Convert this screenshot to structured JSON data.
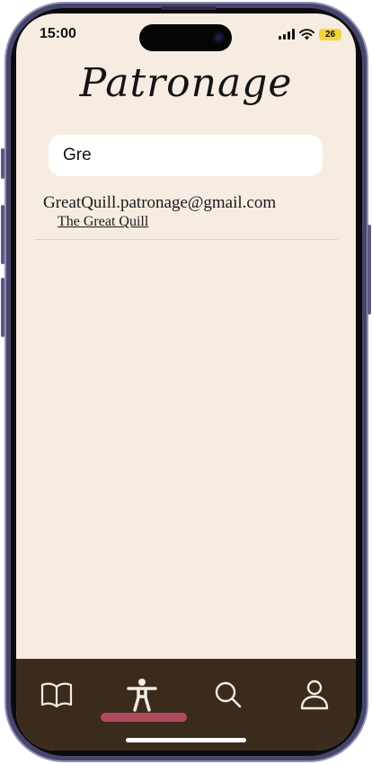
{
  "status_bar": {
    "time": "15:00",
    "battery_level": "26",
    "icons": [
      "signal-icon",
      "wifi-icon",
      "battery-icon"
    ]
  },
  "app": {
    "title": "Patronage"
  },
  "search": {
    "value": "Gre",
    "placeholder": ""
  },
  "results": [
    {
      "email": "GreatQuill.patronage@gmail.com",
      "name": "The Great Quill"
    }
  ],
  "tab_bar": {
    "tabs": [
      {
        "icon": "book-icon",
        "active": false
      },
      {
        "icon": "accessibility-person-icon",
        "active": true
      },
      {
        "icon": "search-icon",
        "active": false
      },
      {
        "icon": "profile-icon",
        "active": false
      }
    ]
  },
  "colors": {
    "background": "#f6ece2",
    "tab_bar": "#3b2b1d",
    "active_indicator": "#b04a5e",
    "device_frame": "#46466c"
  }
}
